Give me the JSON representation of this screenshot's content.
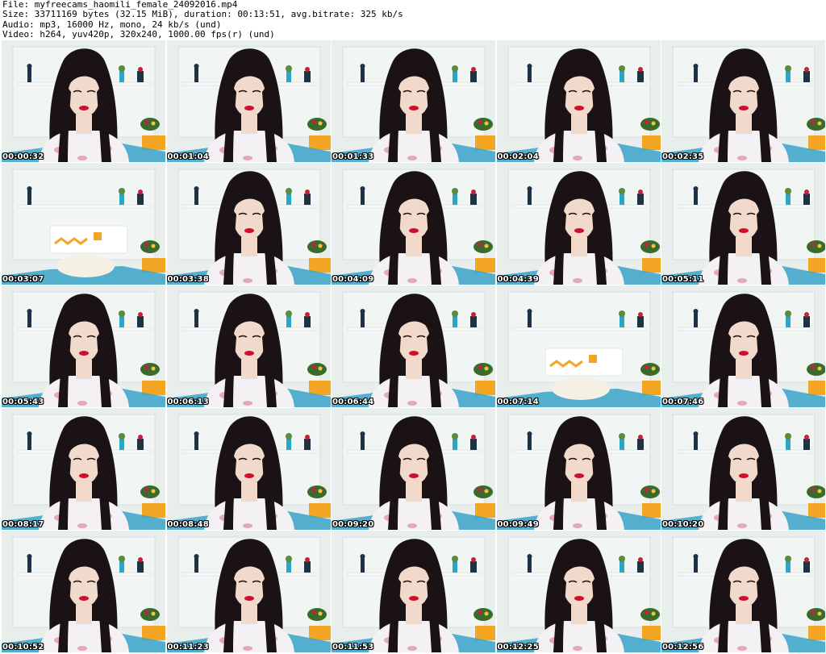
{
  "header": {
    "file_line": "File: myfreecams_haomili_female_24092016.mp4",
    "size_line": "Size: 33711169 bytes (32.15 MiB), duration: 00:13:51, avg.bitrate: 325 kb/s",
    "audio_line": "Audio: mp3, 16000 Hz, mono, 24 kb/s (und)",
    "video_line": "Video: h264, yuv420p, 320x240, 1000.00 fps(r) (und)"
  },
  "thumbnails": [
    {
      "time": "00:00:32",
      "person": true
    },
    {
      "time": "00:01:04",
      "person": true
    },
    {
      "time": "00:01:33",
      "person": true
    },
    {
      "time": "00:02:04",
      "person": true
    },
    {
      "time": "00:02:35",
      "person": true
    },
    {
      "time": "00:03:07",
      "person": false
    },
    {
      "time": "00:03:38",
      "person": true
    },
    {
      "time": "00:04:09",
      "person": true
    },
    {
      "time": "00:04:39",
      "person": true
    },
    {
      "time": "00:05:11",
      "person": true
    },
    {
      "time": "00:05:43",
      "person": true
    },
    {
      "time": "00:06:13",
      "person": true
    },
    {
      "time": "00:06:44",
      "person": true
    },
    {
      "time": "00:07:14",
      "person": false
    },
    {
      "time": "00:07:46",
      "person": true
    },
    {
      "time": "00:08:17",
      "person": true
    },
    {
      "time": "00:08:48",
      "person": true
    },
    {
      "time": "00:09:20",
      "person": true
    },
    {
      "time": "00:09:49",
      "person": true
    },
    {
      "time": "00:10:20",
      "person": true
    },
    {
      "time": "00:10:52",
      "person": true
    },
    {
      "time": "00:11:23",
      "person": true
    },
    {
      "time": "00:11:53",
      "person": true
    },
    {
      "time": "00:12:25",
      "person": true
    },
    {
      "time": "00:12:56",
      "person": true
    }
  ],
  "colors": {
    "wall": "#e8eeec",
    "shelf": "#f7f9f8",
    "hair": "#1a1214",
    "skin": "#f1d9cc",
    "lips": "#d0102a",
    "shirt": "#f3f1f3",
    "shirt_pattern": "#e4a7b8",
    "drawer": "#f3a623",
    "bedding": "#3aa3c9",
    "flowers": "#c8203a"
  }
}
